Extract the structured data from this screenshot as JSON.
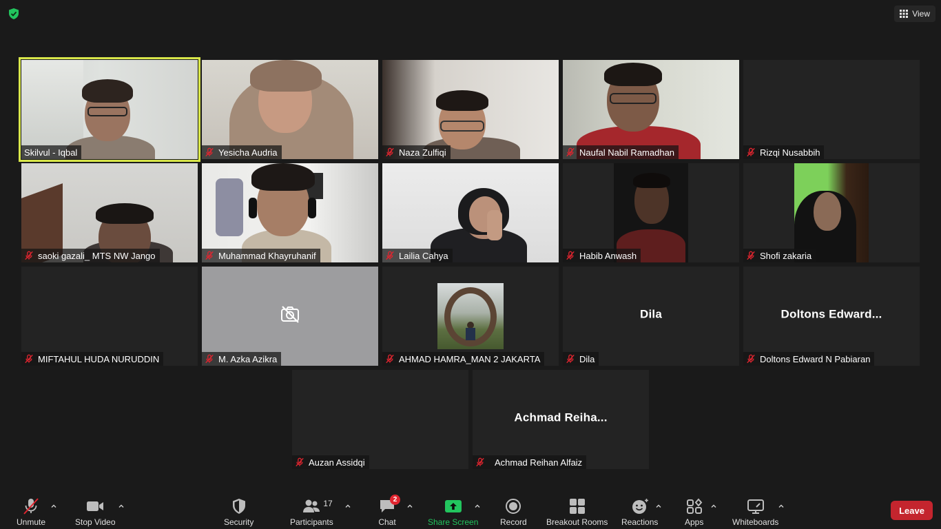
{
  "top": {
    "view_label": "View"
  },
  "participants": [
    {
      "name": "Skilvul - Iqbal"
    },
    {
      "name": "Yesicha Audria"
    },
    {
      "name": "Naza Zulfiqi"
    },
    {
      "name": "Naufal Nabil Ramadhan"
    },
    {
      "name": "Rizqi Nusabbih"
    },
    {
      "name": "saoki gazali_ MTS NW Jango"
    },
    {
      "name": "Muhammad Khayruhanif"
    },
    {
      "name": "Lailia Cahya"
    },
    {
      "name": "Habib Anwash"
    },
    {
      "name": "Shofi zakaria"
    },
    {
      "name": "MIFTAHUL HUDA NURUDDIN"
    },
    {
      "name": "M.  Azka Azikra"
    },
    {
      "name": "AHMAD HAMRA_MAN 2 JAKARTA"
    },
    {
      "name": "Dila",
      "display": "Dila"
    },
    {
      "name": "Doltons Edward N Pabiaran",
      "display": "Doltons  Edward..."
    },
    {
      "name": "Auzan Assidqi"
    },
    {
      "name": "Achmad Reihan Alfaiz",
      "display": "Achmad  Reiha..."
    }
  ],
  "toolbar": {
    "unmute": "Unmute",
    "stop_video": "Stop Video",
    "security": "Security",
    "participants": "Participants",
    "participants_count": "17",
    "chat": "Chat",
    "chat_badge": "2",
    "share_screen": "Share Screen",
    "record": "Record",
    "breakout_rooms": "Breakout Rooms",
    "reactions": "Reactions",
    "apps": "Apps",
    "whiteboards": "Whiteboards",
    "leave": "Leave"
  },
  "colors": {
    "speaker_highlight": "#d9e74a",
    "share_green": "#22c55e",
    "leave_red": "#c4252e",
    "muted_red": "#e0252f"
  }
}
